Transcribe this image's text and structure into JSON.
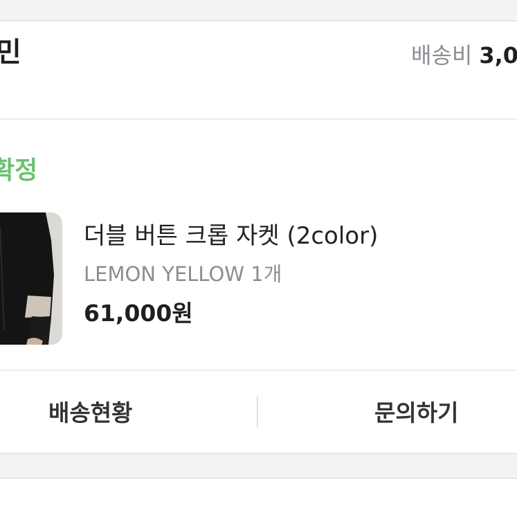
{
  "header": {
    "store_name_fragment": "민",
    "shipping_label": "배송비",
    "shipping_value": "3,0"
  },
  "order": {
    "status_fragment": "확정"
  },
  "product": {
    "name": "더블 버튼 크롭 자켓 (2color)",
    "option": "LEMON YELLOW 1개",
    "price": "61,000원",
    "thumbnail_icon": "product-photo-jacket"
  },
  "actions": {
    "track_label": "배송현황",
    "inquiry_label": "문의하기"
  },
  "colors": {
    "status_green": "#6cc06f",
    "muted_gray": "#8a8d93",
    "text_dark": "#1f1f1f"
  }
}
